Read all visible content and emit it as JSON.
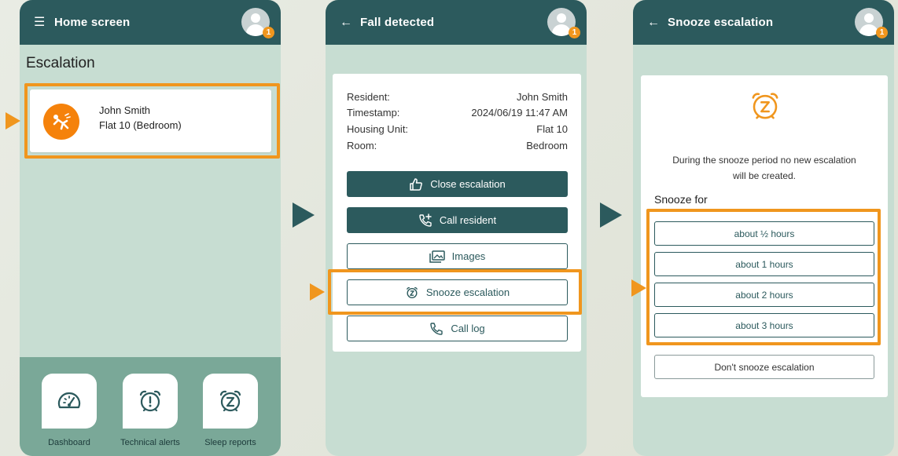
{
  "colors": {
    "header": "#2c5a5d",
    "background": "#c7ddd2",
    "accent": "#f0961e",
    "alert": "#f5820b",
    "nav_bar": "#7aa898"
  },
  "home": {
    "menu_icon": "hamburger-icon",
    "title": "Home screen",
    "notification_count": "1",
    "section_title": "Escalation",
    "escalation": {
      "icon": "person-falling-icon",
      "name": "John Smith",
      "location": "Flat 10 (Bedroom)"
    },
    "bottom_nav": [
      {
        "label": "Dashboard",
        "icon": "gauge-icon"
      },
      {
        "label": "Technical alerts",
        "icon": "alarm-exclamation-icon"
      },
      {
        "label": "Sleep reports",
        "icon": "alarm-snooze-icon"
      }
    ]
  },
  "fall": {
    "back_icon": "arrow-left-icon",
    "title": "Fall detected",
    "notification_count": "1",
    "details": [
      {
        "label": "Resident:",
        "value": "John Smith"
      },
      {
        "label": "Timestamp:",
        "value": "2024/06/19 11:47 AM"
      },
      {
        "label": "Housing Unit:",
        "value": "Flat 10"
      },
      {
        "label": "Room:",
        "value": "Bedroom"
      }
    ],
    "actions": {
      "close": "Close escalation",
      "call": "Call resident",
      "images": "Images",
      "snooze": "Snooze escalation",
      "call_log": "Call log"
    }
  },
  "snooze": {
    "back_icon": "arrow-left-icon",
    "title": "Snooze escalation",
    "notification_count": "1",
    "icon": "alarm-snooze-icon",
    "description": "During the snooze period no new escalation will be created.",
    "section_label": "Snooze for",
    "options": [
      "about ½ hours",
      "about 1 hours",
      "about 2 hours",
      "about 3 hours"
    ],
    "dont_snooze": "Don't snooze escalation"
  }
}
